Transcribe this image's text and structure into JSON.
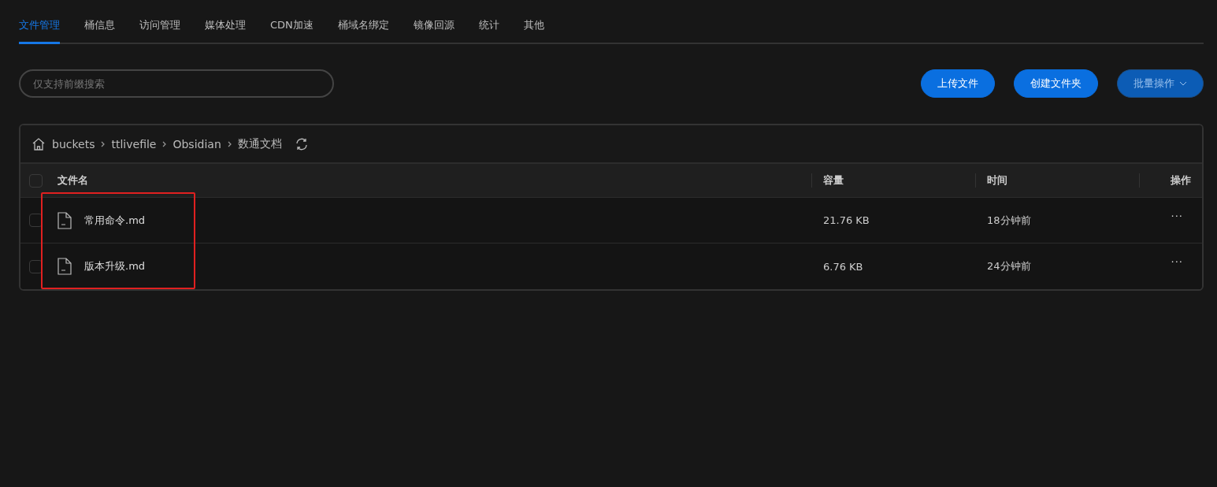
{
  "tabs": [
    {
      "label": "文件管理",
      "selected": true
    },
    {
      "label": "桶信息",
      "selected": false
    },
    {
      "label": "访问管理",
      "selected": false
    },
    {
      "label": "媒体处理",
      "selected": false
    },
    {
      "label": "CDN加速",
      "selected": false
    },
    {
      "label": "桶域名绑定",
      "selected": false
    },
    {
      "label": "镜像回源",
      "selected": false
    },
    {
      "label": "统计",
      "selected": false
    },
    {
      "label": "其他",
      "selected": false
    }
  ],
  "search": {
    "placeholder": "仅支持前缀搜索"
  },
  "buttons": [
    {
      "label": "上传文件",
      "disabled": false
    },
    {
      "label": "创建文件夹",
      "disabled": false
    },
    {
      "label": "批量操作",
      "disabled": true,
      "dropdown": true
    }
  ],
  "breadcrumb": [
    "buckets",
    "ttlivefile",
    "Obsidian",
    "数通文档"
  ],
  "table": {
    "all_checked": false,
    "columns": [
      "文件名",
      "容量",
      "时间",
      "操作"
    ],
    "rows": [
      {
        "name": "常用命令.md",
        "size": "21.76 KB",
        "time": "18分钟前",
        "actions": "···",
        "checked": false
      },
      {
        "name": "版本升级.md",
        "size": "6.76 KB",
        "time": "24分钟前",
        "actions": "···",
        "checked": false
      }
    ]
  }
}
